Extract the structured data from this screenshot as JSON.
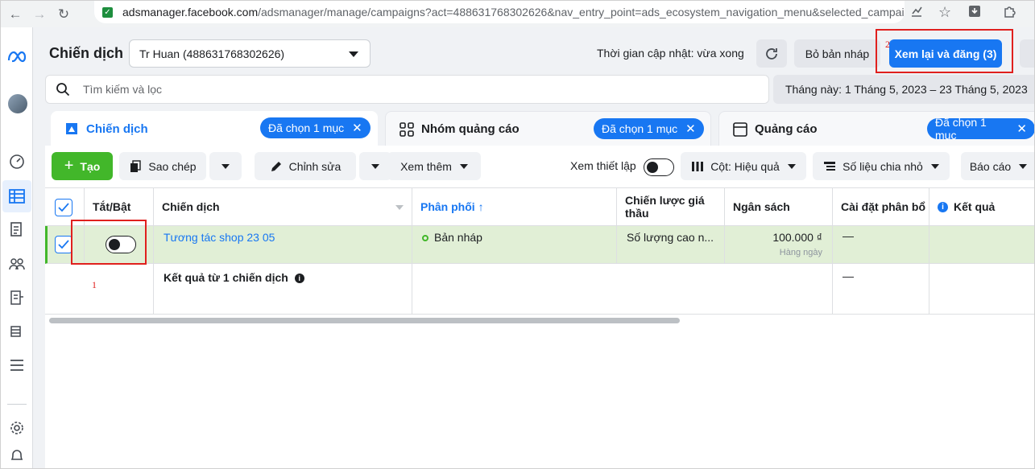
{
  "browser": {
    "url_host": "adsmanager.facebook.com",
    "url_path": "/adsmanager/manage/campaigns?act=488631768302626&nav_entry_point=ads_ecosystem_navigation_menu&selected_campai..."
  },
  "header": {
    "title": "Chiến dịch",
    "account": "Tr Huan (488631768302626)",
    "update_status": "Thời gian cập nhật: vừa xong",
    "discard_label": "Bỏ bản nháp",
    "publish_label": "Xem lại và đăng (3)"
  },
  "search": {
    "placeholder": "Tìm kiếm và lọc",
    "date_range": "Tháng này: 1 Tháng 5, 2023 – 23 Tháng 5, 2023"
  },
  "tabs": [
    {
      "label": "Chiến dịch",
      "chip": "Đã chọn 1 mục"
    },
    {
      "label": "Nhóm quảng cáo",
      "chip": "Đã chọn 1 mục"
    },
    {
      "label": "Quảng cáo",
      "chip": "Đã chọn 1 mục"
    }
  ],
  "toolbar": {
    "create": "Tạo",
    "copy": "Sao chép",
    "edit": "Chỉnh sửa",
    "more": "Xem thêm",
    "setup": "Xem thiết lập",
    "columns": "Cột: Hiệu quả",
    "breakdown": "Số liệu chia nhỏ",
    "reports": "Báo cáo"
  },
  "table": {
    "headers": {
      "toggle": "Tắt/Bật",
      "campaign": "Chiến dịch",
      "delivery": "Phân phối",
      "bid_strategy": "Chiến lược giá thầu",
      "budget": "Ngân sách",
      "attribution": "Cài đặt phân bổ",
      "results": "Kết quả"
    },
    "row": {
      "campaign": "Tương tác shop 23 05",
      "delivery": "Bản nháp",
      "bid_strategy": "Số lượng cao n...",
      "budget": "100.000 ₫",
      "budget_period": "Hàng ngày",
      "attribution": "—",
      "toggle_on": false
    },
    "summary": {
      "label": "Kết quả từ 1 chiến dịch",
      "attribution": "—"
    }
  },
  "annotations": {
    "box1_label": "1",
    "box2_label": "2",
    "color": "#e0201e"
  },
  "colors": {
    "primary": "#1877f2",
    "success": "#42b72a",
    "draft_row_bg": "#e1efd6"
  }
}
